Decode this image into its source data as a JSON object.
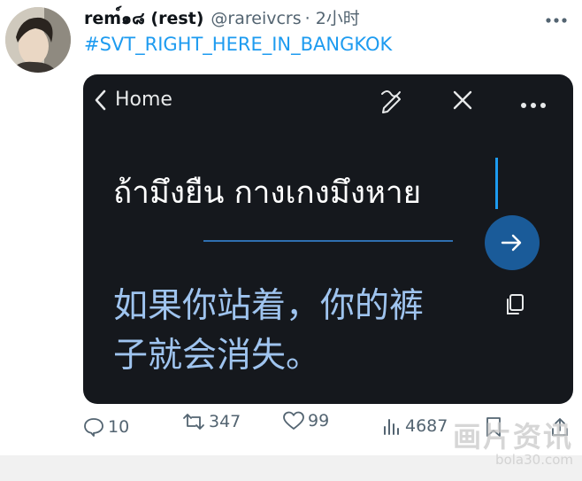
{
  "tweet": {
    "display_name": "rem์๑๘ (rest)",
    "handle": "@rareivcrs",
    "time": "· 2小时",
    "hashtag": "#SVT_RIGHT_HERE_IN_BANGKOK"
  },
  "media": {
    "back_label": "Home",
    "thai_input": "ถ้ามึงยืน กางเกงมึงหาย",
    "translation_line1": "如果你站着，你的裤",
    "translation_line2": "子就会消失。"
  },
  "actions": {
    "reply_count": "10",
    "retweet_count": "347",
    "like_count": "99",
    "view_count": "4687"
  },
  "watermark": {
    "main": "画片资讯",
    "sub": "bola30.com"
  },
  "colors": {
    "link": "#1d9bf0",
    "media_bg": "#15181d",
    "translation": "#9fc4ef",
    "action": "#536471"
  }
}
